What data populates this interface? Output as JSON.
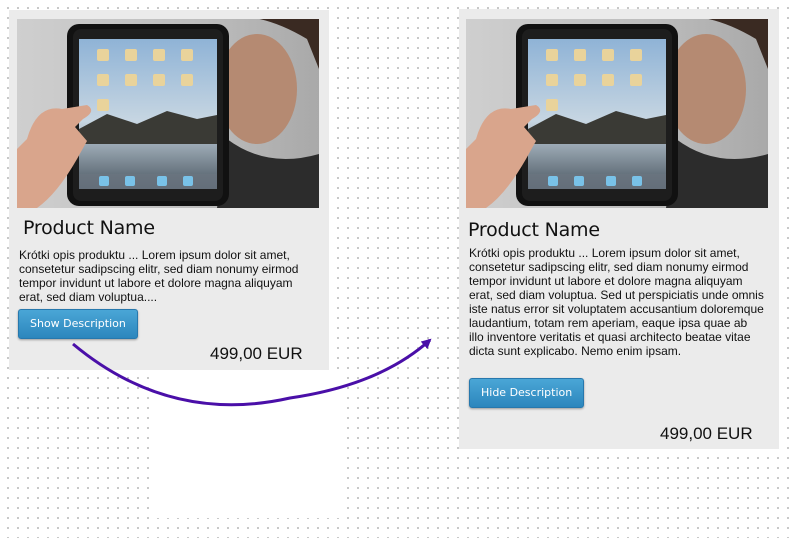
{
  "cards": [
    {
      "state": "collapsed",
      "product_name": "Product Name",
      "description": "Krótki opis produktu ... Lorem ipsum dolor sit amet, consetetur sadipscing elitr, sed diam nonumy eirmod tempor invidunt ut labore et dolore magna aliquyam erat, sed diam voluptua....",
      "button_label": "Show Description",
      "price": "499,00 EUR"
    },
    {
      "state": "expanded",
      "product_name": "Product Name",
      "description": "Krótki opis produktu ... Lorem ipsum dolor sit amet, consetetur sadipscing elitr, sed diam nonumy eirmod tempor invidunt ut labore et dolore magna aliquyam erat, sed diam voluptua. Sed ut perspiciatis unde omnis iste natus error sit voluptatem accusantium doloremque laudantium, totam rem aperiam, eaque ipsa quae ab illo inventore veritatis et quasi architecto beatae vitae dicta sunt explicabo. Nemo enim ipsam.",
      "button_label": "Hide Description",
      "price": "499,00 EUR"
    }
  ],
  "colors": {
    "card_bg": "#ebebeb",
    "button_bg": "#3796cb",
    "arrow": "#4a0fa8"
  },
  "icons": [
    "tablet-product-image",
    "transition-arrow-icon"
  ]
}
